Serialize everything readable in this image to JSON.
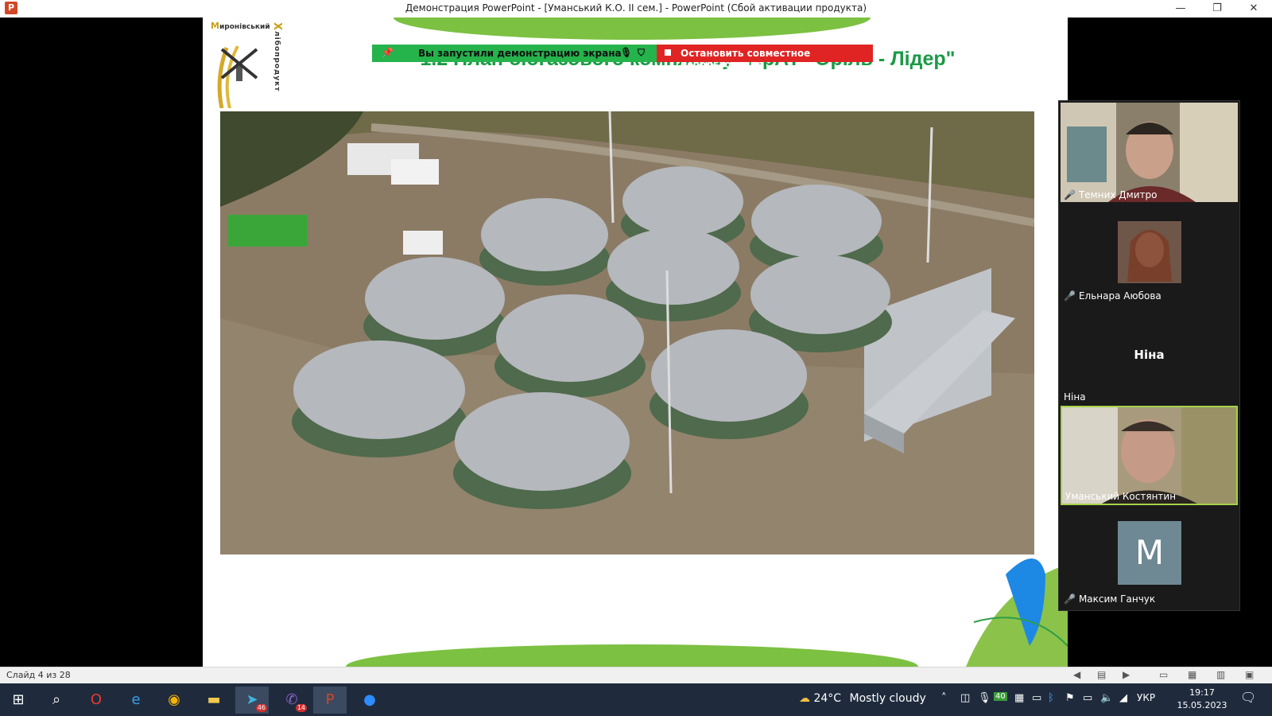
{
  "window": {
    "title": "Демонстрация PowerPoint - [Уманський К.О. ІІ  сем.] - PowerPoint (Сбой активации продукта)",
    "app_icon": "P",
    "minimize_icon": "—",
    "restore_icon": "❐",
    "close_icon": "✕"
  },
  "slide": {
    "title": "1.2 План біогазового комплексу \"ПрАТ \"Оріль - Лідер\"",
    "logo_line1_prefix": "М",
    "logo_line1_rest": "иронівський",
    "logo_vertical_first": "Х",
    "logo_vertical_rest": "лібопродукт"
  },
  "share_bar": {
    "pin_icon": "📌",
    "status_text": "Вы запустили демонстрацию экрана",
    "mic_icon": "🎙",
    "shield_icon": "⛉",
    "stop_label": "Остановить совместное использование"
  },
  "participants": [
    {
      "name": "Темних Дмитро",
      "muted": true
    },
    {
      "name": "Ельнара Аюбова",
      "muted": true
    },
    {
      "name": "Ніна",
      "muted": false,
      "display_name": "Ніна"
    },
    {
      "name": "Уманський Костянтин",
      "muted": false,
      "active": true
    },
    {
      "name": "Максим Ганчук",
      "muted": true,
      "avatar_letter": "M"
    }
  ],
  "status_bar": {
    "slide_info": "Слайд 4 из 28"
  },
  "taskbar": {
    "weather_temp": "24°C",
    "weather_text": "Mostly cloudy",
    "telegram_badge": "46",
    "viber_badge": "14",
    "language": "УКР",
    "time": "19:17",
    "date": "15.05.2023",
    "tray_number": "40"
  },
  "colors": {
    "title_green": "#1a9a45",
    "share_green": "#25b34b",
    "share_red": "#e02424",
    "active_speaker_border": "#a6d24a",
    "taskbar_bg": "#1f2b3d"
  }
}
